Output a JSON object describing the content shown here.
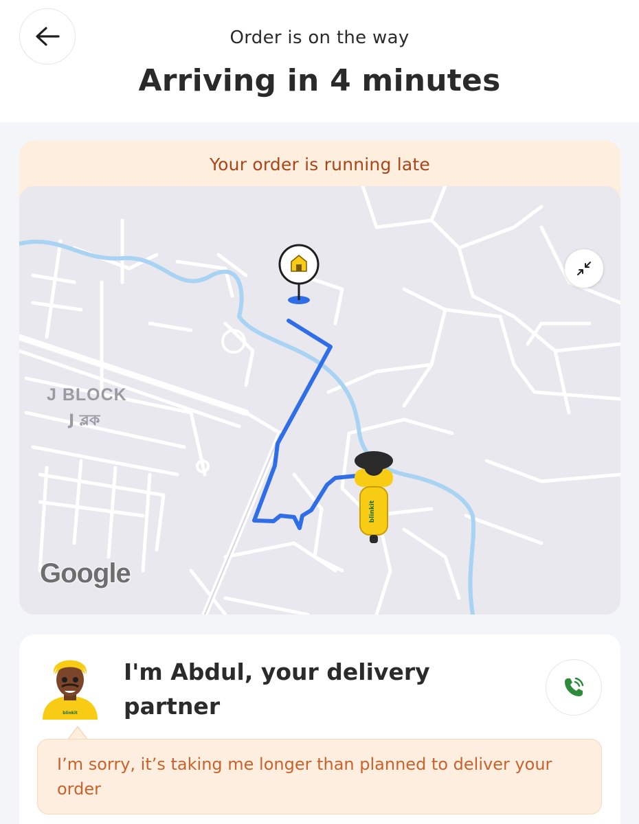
{
  "header": {
    "subtitle": "Order is on the way",
    "title": "Arriving in 4 minutes"
  },
  "status_banner": {
    "text": "Your order is running late",
    "color": "#a8461b",
    "background": "#fdeedd"
  },
  "map": {
    "area_label": "J BLOCK",
    "area_label_local": "J ব্লক",
    "attribution": "Google",
    "route_color": "#2f6ee6",
    "river_color": "#a9d3f2"
  },
  "partner": {
    "intro": "I'm Abdul, your delivery partner",
    "message": "I’m sorry, it’s taking me longer than planned to deliver your order",
    "helmet_brand": "blinkit",
    "brand_color": "#f8cb15"
  },
  "icons": {
    "back": "arrow-left-icon",
    "collapse": "collapse-arrows-icon",
    "home": "home-pin-icon",
    "call": "phone-call-icon"
  }
}
